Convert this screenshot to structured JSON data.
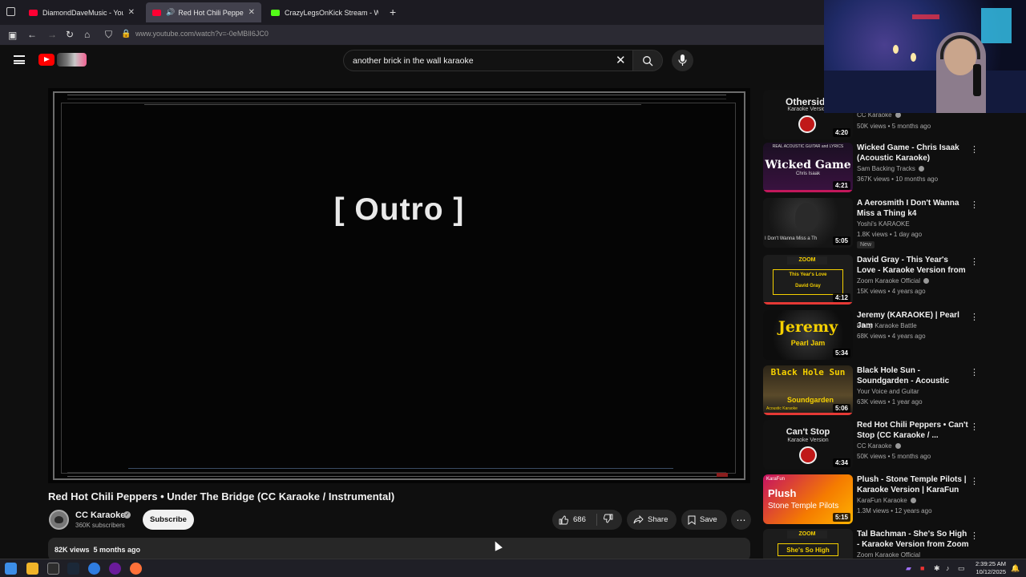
{
  "browser": {
    "tabs": [
      {
        "label": "DiamondDaveMusic - YouTube",
        "active": false
      },
      {
        "label": "Red Hot Chili Peppers - Und",
        "active": true
      },
      {
        "label": "CrazyLegsOnKick Stream - Watc",
        "active": false
      }
    ],
    "url": "www.youtube.com/watch?v=-0eMBlI6JC0"
  },
  "search": {
    "query": "another brick in the wall karaoke"
  },
  "player": {
    "lyric": "[ Outro ]"
  },
  "video": {
    "title": "Red Hot Chili Peppers • Under The Bridge (CC Karaoke / Instrumental)",
    "channel": "CC Karaoke",
    "subscribers": "360K subscribers",
    "subscribe_label": "Subscribe",
    "likes": "686",
    "share_label": "Share",
    "save_label": "Save",
    "views": "82K views",
    "age": "5 months ago"
  },
  "sidebar": {
    "items": [
      {
        "thumb_text": "Otherside",
        "thumb_sub": "Karaoke Version",
        "duration": "4:20",
        "title": "",
        "channel": "CC Karaoke",
        "meta": "50K views • 5 months ago",
        "badge": ""
      },
      {
        "thumb_text": "Wicked Game",
        "thumb_sub": "Chris Isaak",
        "duration": "4:21",
        "title": "Wicked Game - Chris Isaak (Acoustic Karaoke)",
        "channel": "Sam Backing Tracks",
        "meta": "367K views • 10 months ago",
        "badge": ""
      },
      {
        "thumb_text": "I Don't Wanna Miss a Th",
        "thumb_sub": "",
        "duration": "5:05",
        "title": "A Aerosmith I Don't Wanna Miss a Thing k4",
        "channel": "Yoshi's KARAOKE",
        "meta": "1.8K views • 1 day ago",
        "badge": "New"
      },
      {
        "thumb_text": "This Year's Love",
        "thumb_sub": "David Gray",
        "duration": "4:12",
        "title": "David Gray - This Year's Love - Karaoke Version from Zoom ...",
        "channel": "Zoom Karaoke Official",
        "meta": "15K views • 4 years ago",
        "badge": ""
      },
      {
        "thumb_text": "Jeremy",
        "thumb_sub": "Pearl Jam",
        "duration": "5:34",
        "title": "Jeremy (KARAOKE) | Pearl Jam",
        "channel": "Pinoy Karaoke Battle",
        "meta": "68K views • 4 years ago",
        "badge": ""
      },
      {
        "thumb_text": "Black Hole Sun",
        "thumb_sub": "Soundgarden",
        "duration": "5:06",
        "title": "Black Hole Sun - Soundgarden - Acoustic Karaoke",
        "channel": "Your Voice and Guitar",
        "meta": "63K views • 1 year ago",
        "badge": ""
      },
      {
        "thumb_text": "Can't Stop",
        "thumb_sub": "Karaoke Version",
        "duration": "4:34",
        "title": "Red Hot Chili Peppers • Can't Stop (CC Karaoke / ...",
        "channel": "CC Karaoke",
        "meta": "50K views • 5 months ago",
        "badge": ""
      },
      {
        "thumb_text": "Plush",
        "thumb_sub": "Stone Temple Pilots",
        "duration": "5:15",
        "title": "Plush - Stone Temple Pilots | Karaoke Version | KaraFun",
        "channel": "KaraFun Karaoke",
        "meta": "1.3M views • 12 years ago",
        "badge": ""
      },
      {
        "thumb_text": "She's So High",
        "thumb_sub": "",
        "duration": "",
        "title": "Tal Bachman - She's So High - Karaoke Version from Zoom ...",
        "channel": "Zoom Karaoke Official",
        "meta": "",
        "badge": ""
      }
    ]
  },
  "taskbar": {
    "time": "2:39:25 AM",
    "date": "10/12/2025"
  },
  "colors": {
    "background": "#0f0f0f",
    "accent": "#ff0000",
    "surface": "#272727",
    "browser_chrome": "#1c1b22"
  }
}
